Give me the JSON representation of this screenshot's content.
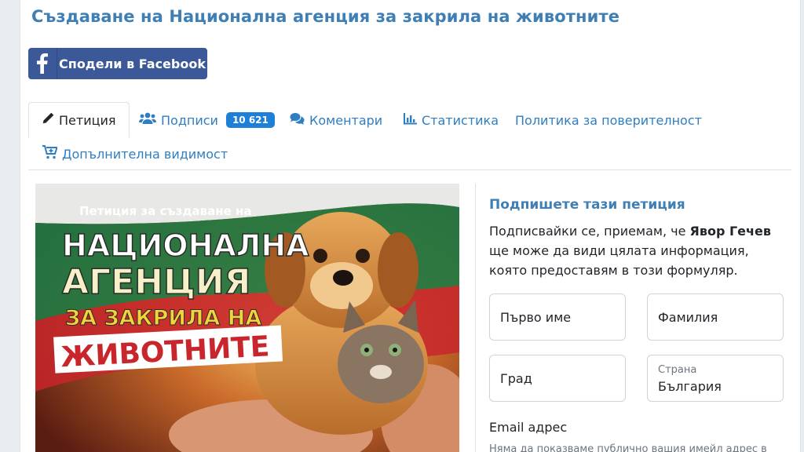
{
  "page": {
    "title": "Създаване на Национална агенция за закрила на животните"
  },
  "share": {
    "facebook_label": "Сподели в Facebook"
  },
  "tabs": [
    {
      "label": "Петиция",
      "icon": "pencil-icon"
    },
    {
      "label": "Подписи",
      "icon": "users-icon",
      "badge": "10 621"
    },
    {
      "label": "Коментари",
      "icon": "comments-icon"
    },
    {
      "label": "Статистика",
      "icon": "bar-chart-icon"
    },
    {
      "label": "Политика за поверителност"
    },
    {
      "label": "Допълнителна видимост",
      "icon": "cart-plus-icon"
    }
  ],
  "hero": {
    "subtitle": "Петиция за създаване на",
    "line1": "НАЦИОНАЛНА",
    "line2": "АГЕНЦИЯ",
    "line3": "ЗА ЗАКРИЛА НА",
    "line4": "ЖИВОТНИТЕ"
  },
  "form": {
    "title": "Подпишете тази петиция",
    "intro_before": "Подписвайки се, приемам, че ",
    "intro_name": "Явор Гечев",
    "intro_after": " ще може да види цялата информация, която предоставям в този формуляр.",
    "first_name_placeholder": "Първо име",
    "last_name_placeholder": "Фамилия",
    "city_placeholder": "Град",
    "country_label": "Страна",
    "country_value": "България",
    "email_label": "Email адрес",
    "email_note": "Няма да показваме публично вашия имейл адрес в"
  },
  "colors": {
    "title": "#3f7fb3",
    "link": "#2f7ec1",
    "facebook": "#3b5998",
    "badge": "#1e7fd6"
  }
}
